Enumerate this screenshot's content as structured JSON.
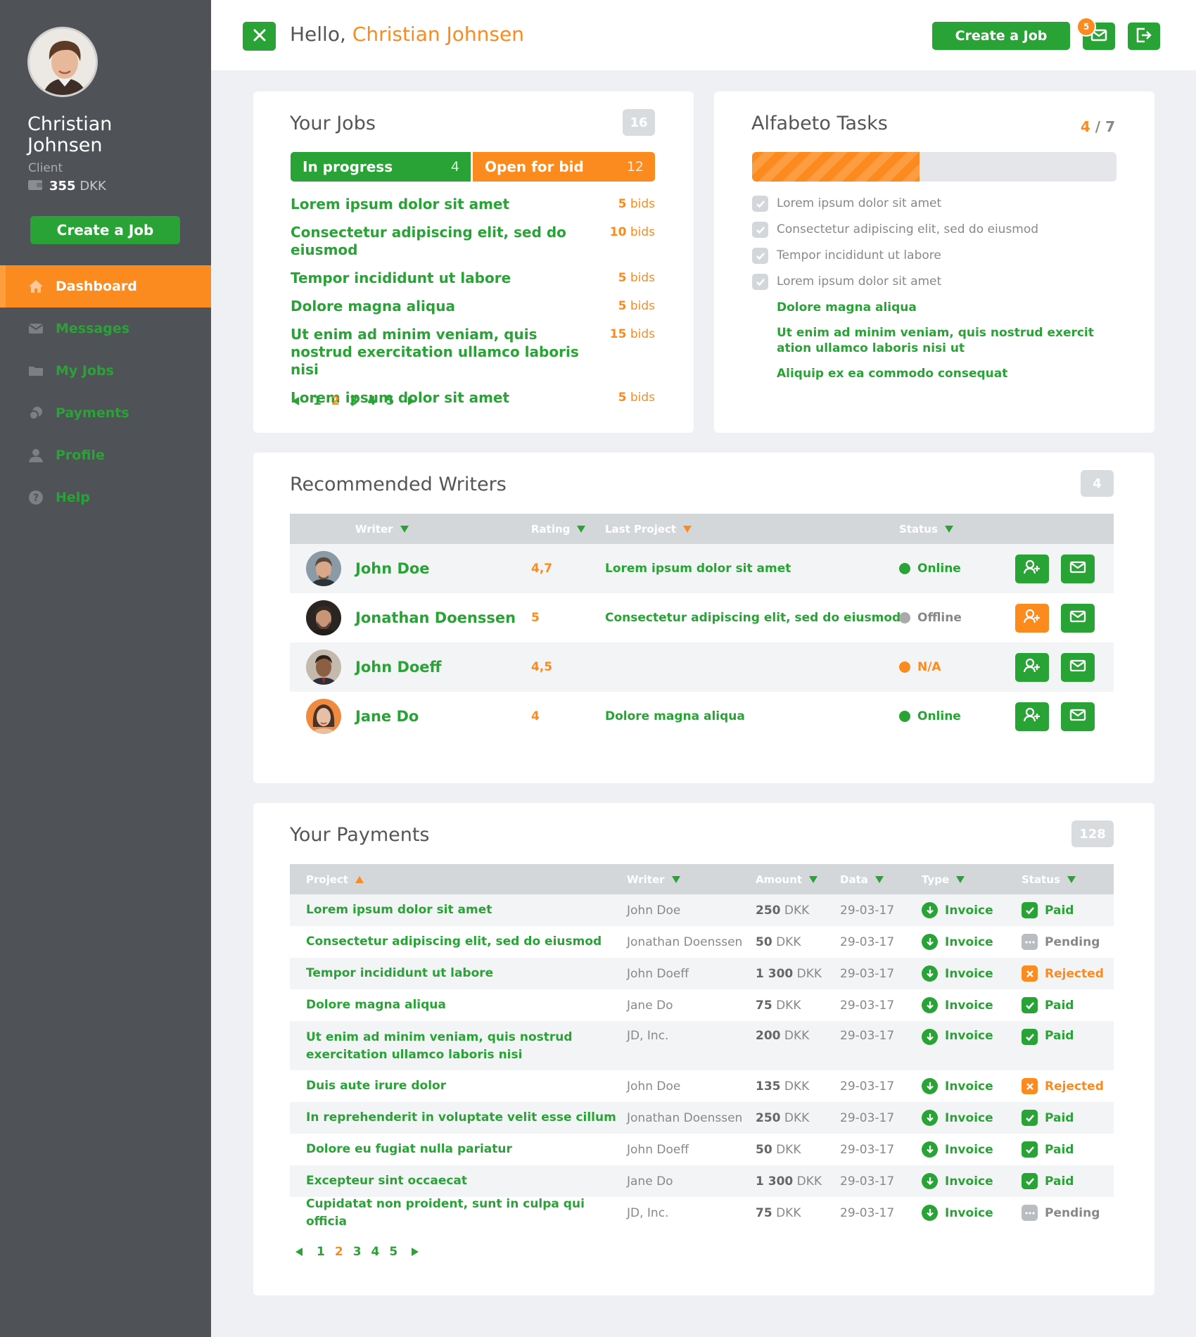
{
  "user": {
    "name": "Christian Johnsen",
    "role": "Client",
    "balance_amount": "355",
    "balance_currency": "DKK"
  },
  "sidebar": {
    "create_label": "Create a Job",
    "items": [
      {
        "label": "Dashboard",
        "icon": "home-icon"
      },
      {
        "label": "Messages",
        "icon": "envelope-icon"
      },
      {
        "label": "My Jobs",
        "icon": "folder-icon"
      },
      {
        "label": "Payments",
        "icon": "coins-icon"
      },
      {
        "label": "Profile",
        "icon": "user-icon"
      },
      {
        "label": "Help",
        "icon": "help-icon"
      }
    ]
  },
  "header": {
    "greeting": "Hello,",
    "name": "Christian Johnsen",
    "create_label": "Create a Job",
    "mail_count": "5"
  },
  "jobs": {
    "title": "Your Jobs",
    "count": "16",
    "in_progress": {
      "label": "In progress",
      "count": "4"
    },
    "open_for_bid": {
      "label": "Open for bid",
      "count": "12"
    },
    "items": [
      {
        "title": "Lorem ipsum dolor sit amet",
        "bids": "5",
        "bids_unit": "bids"
      },
      {
        "title": "Consectetur adipiscing elit, sed do eiusmod",
        "bids": "10",
        "bids_unit": "bids"
      },
      {
        "title": "Tempor incididunt ut labore",
        "bids": "5",
        "bids_unit": "bids"
      },
      {
        "title": "Dolore magna aliqua",
        "bids": "5",
        "bids_unit": "bids"
      },
      {
        "title": "Ut enim ad minim veniam, quis nostrud exercitation ullamco laboris nisi",
        "bids": "15",
        "bids_unit": "bids"
      },
      {
        "title": "Lorem ipsum dolor sit amet",
        "bids": "5",
        "bids_unit": "bids"
      }
    ],
    "pages": [
      "1",
      "2",
      "3",
      "4",
      "5"
    ],
    "current_page": "2"
  },
  "tasks": {
    "title": "Alfabeto Tasks",
    "done": "4",
    "separator": "/",
    "total": "7",
    "progress": 0.46,
    "items": [
      {
        "text": "Lorem ipsum dolor sit amet",
        "done": true
      },
      {
        "text": "Consectetur adipiscing elit, sed do eiusmod",
        "done": true
      },
      {
        "text": "Tempor incididunt ut labore",
        "done": true
      },
      {
        "text": "Lorem ipsum dolor sit amet",
        "done": true
      },
      {
        "text": "Dolore magna aliqua",
        "done": false
      },
      {
        "text": "Ut enim ad minim veniam, quis nostrud exercit ation ullamco laboris nisi ut",
        "done": false
      },
      {
        "text": "Aliquip ex ea commodo consequat",
        "done": false
      }
    ]
  },
  "writers": {
    "title": "Recommended Writers",
    "count": "4",
    "headers": {
      "writer": "Writer",
      "rating": "Rating",
      "last_project": "Last Project",
      "status": "Status"
    },
    "rows": [
      {
        "name": "John Doe",
        "rating": "4,7",
        "project": "Lorem ipsum dolor sit amet",
        "status": "Online",
        "status_color": "#2aa336",
        "add_color": "#2aa336"
      },
      {
        "name": "Jonathan Doenssen",
        "rating": "5",
        "project": "Consectetur adipiscing elit, sed do eiusmod",
        "status": "Offline",
        "status_color": "#aaaaaa",
        "add_color": "#fb8b1e"
      },
      {
        "name": "John Doeff",
        "rating": "4,5",
        "project": "",
        "status": "N/A",
        "status_color": "#fb8b1e",
        "add_color": "#2aa336"
      },
      {
        "name": "Jane Do",
        "rating": "4",
        "project": "Dolore magna aliqua",
        "status": "Online",
        "status_color": "#2aa336",
        "add_color": "#2aa336"
      }
    ]
  },
  "payments": {
    "title": "Your Payments",
    "count": "128",
    "headers": {
      "project": "Project",
      "writer": "Writer",
      "amount": "Amount",
      "date": "Data",
      "type": "Type",
      "status": "Status"
    },
    "rows": [
      {
        "project": "Lorem ipsum dolor sit amet",
        "writer": "John Doe",
        "amount": "250",
        "currency": "DKK",
        "date": "29-03-17",
        "type": "Invoice",
        "status": "Paid"
      },
      {
        "project": "Consectetur adipiscing elit, sed do eiusmod",
        "writer": "Jonathan Doenssen",
        "amount": "50",
        "currency": "DKK",
        "date": "29-03-17",
        "type": "Invoice",
        "status": "Pending"
      },
      {
        "project": "Tempor incididunt ut labore",
        "writer": "John Doeff",
        "amount": "1 300",
        "currency": "DKK",
        "date": "29-03-17",
        "type": "Invoice",
        "status": "Rejected"
      },
      {
        "project": "Dolore magna aliqua",
        "writer": "Jane Do",
        "amount": "75",
        "currency": "DKK",
        "date": "29-03-17",
        "type": "Invoice",
        "status": "Paid"
      },
      {
        "project": "Ut enim ad minim veniam, quis nostrud exercitation ullamco laboris nisi",
        "writer": "JD, Inc.",
        "amount": "200",
        "currency": "DKK",
        "date": "29-03-17",
        "type": "Invoice",
        "status": "Paid"
      },
      {
        "project": "Duis aute irure dolor",
        "writer": "John Doe",
        "amount": "135",
        "currency": "DKK",
        "date": "29-03-17",
        "type": "Invoice",
        "status": "Rejected"
      },
      {
        "project": "In reprehenderit in voluptate velit esse cillum",
        "writer": "Jonathan Doenssen",
        "amount": "250",
        "currency": "DKK",
        "date": "29-03-17",
        "type": "Invoice",
        "status": "Paid"
      },
      {
        "project": "Dolore eu fugiat nulla pariatur",
        "writer": "John Doeff",
        "amount": "50",
        "currency": "DKK",
        "date": "29-03-17",
        "type": "Invoice",
        "status": "Paid"
      },
      {
        "project": "Excepteur sint occaecat",
        "writer": "Jane Do",
        "amount": "1 300",
        "currency": "DKK",
        "date": "29-03-17",
        "type": "Invoice",
        "status": "Paid"
      },
      {
        "project": "Cupidatat non proident, sunt in culpa qui officia",
        "writer": "JD, Inc.",
        "amount": "75",
        "currency": "DKK",
        "date": "29-03-17",
        "type": "Invoice",
        "status": "Pending"
      }
    ],
    "pages": [
      "1",
      "2",
      "3",
      "4",
      "5"
    ],
    "current_page": "2"
  },
  "colors": {
    "green": "#2aa336",
    "orange": "#fb8b1e",
    "sidebar": "#4f5358",
    "gray": "#d4d7da"
  }
}
